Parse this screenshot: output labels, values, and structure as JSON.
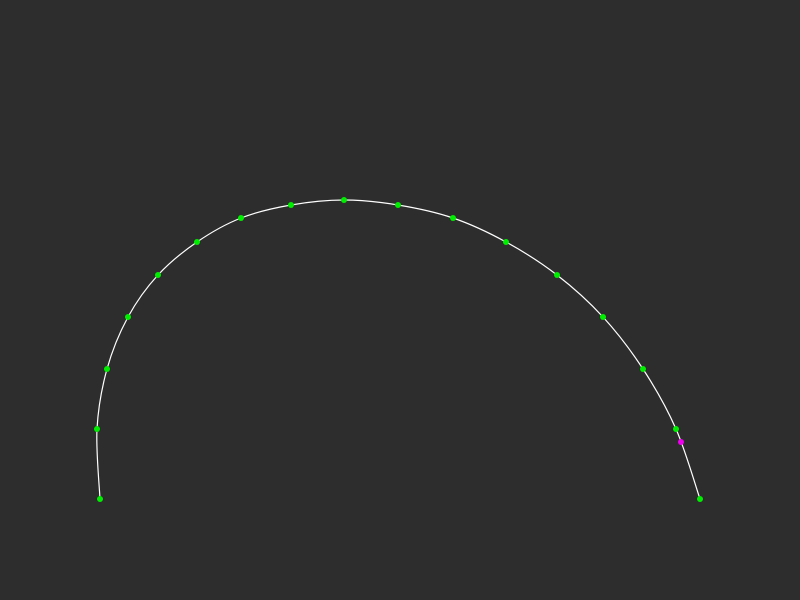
{
  "scene": {
    "background": "#2d2d2d",
    "curve_color": "#ffffff",
    "point_color": "#00ee00",
    "highlight_color": "#ee00ee",
    "control_point_count": 18,
    "highlighted_point_count": 1
  }
}
